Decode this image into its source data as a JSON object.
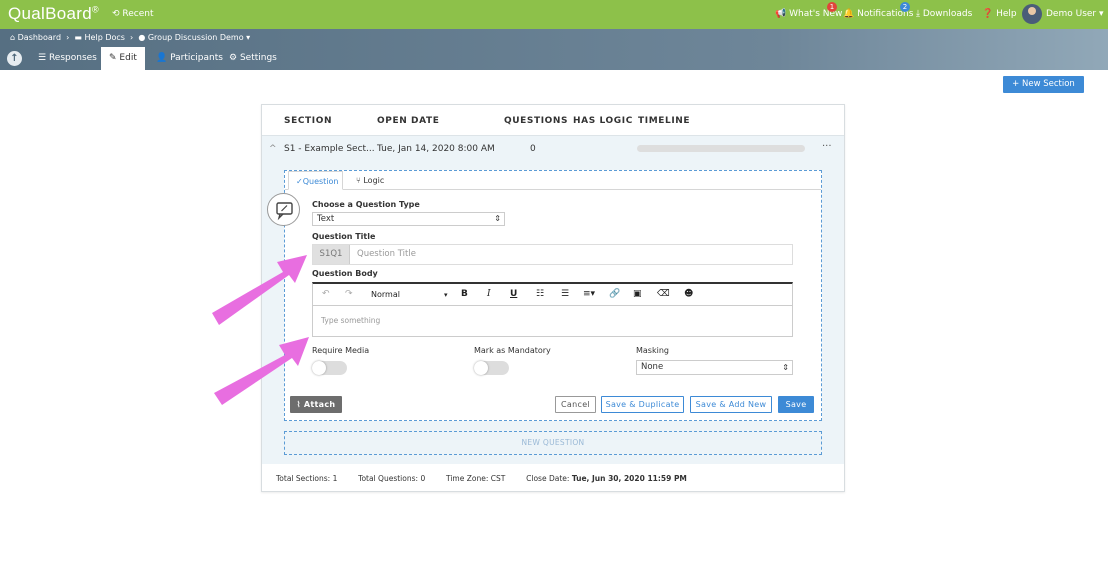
{
  "app": {
    "logo": "QualBoard",
    "logo_mark": "®",
    "recent": "Recent"
  },
  "topnav": {
    "whats_new": "What's New",
    "whats_new_badge": "1",
    "notifications": "Notifications",
    "notifications_badge": "2",
    "downloads": "Downloads",
    "help": "Help",
    "user": "Demo User"
  },
  "breadcrumb": {
    "dashboard": "Dashboard",
    "help_docs": "Help Docs",
    "project": "Group Discussion Demo"
  },
  "subnav": {
    "responses": "Responses",
    "edit": "Edit",
    "participants": "Participants",
    "settings": "Settings"
  },
  "actions": {
    "new_section": "+ New Section"
  },
  "table": {
    "headers": {
      "section": "SECTION",
      "open_date": "OPEN DATE",
      "questions": "QUESTIONS",
      "has_logic": "HAS LOGIC",
      "timeline": "TIMELINE"
    },
    "row": {
      "section": "S1 - Example Sect...",
      "open_date": "Tue, Jan 14, 2020 8:00 AM",
      "questions": "0",
      "more": "···"
    }
  },
  "editor": {
    "tab_question": "Question",
    "tab_logic": "Logic",
    "choose_type_label": "Choose a Question Type",
    "type_value": "Text",
    "title_label": "Question Title",
    "title_prefix": "S1Q1",
    "title_placeholder": "Question Title",
    "body_label": "Question Body",
    "format_value": "Normal",
    "body_placeholder": "Type something",
    "require_media": "Require Media",
    "mark_mandatory": "Mark as Mandatory",
    "masking": "Masking",
    "masking_value": "None",
    "attach": "Attach",
    "cancel": "Cancel",
    "save_duplicate": "Save & Duplicate",
    "save_add_new": "Save & Add New",
    "save": "Save",
    "new_question": "NEW QUESTION"
  },
  "footer": {
    "total_sections_label": "Total Sections:",
    "total_sections": "1",
    "total_questions_label": "Total Questions:",
    "total_questions": "0",
    "timezone_label": "Time Zone:",
    "timezone": "CST",
    "close_date_label": "Close Date:",
    "close_date": "Tue, Jun 30, 2020 11:59 PM"
  },
  "colors": {
    "brand_green": "#8dc14a",
    "primary_blue": "#3d8ad6",
    "annotation_arrow": "#e86ee0"
  }
}
